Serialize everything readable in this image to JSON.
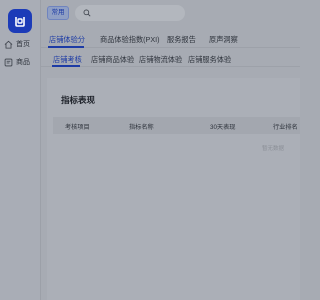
{
  "sidebar": {
    "logo_icon": "app-logo-icon",
    "items": [
      {
        "label": "首页",
        "icon": "home-icon"
      },
      {
        "label": "商品",
        "icon": "product-icon"
      }
    ]
  },
  "topbar": {
    "tag": "常用",
    "search_icon": "search-icon",
    "search_placeholder": ""
  },
  "primary_tabs": [
    {
      "label": "店铺体验分",
      "active": true
    },
    {
      "label": "商品体验指数(PXI)",
      "active": false
    },
    {
      "label": "服务报告",
      "active": false
    },
    {
      "label": "原声洞察",
      "active": false
    }
  ],
  "secondary_tabs": [
    {
      "label": "店铺考核",
      "active": true
    },
    {
      "label": "店铺商品体验",
      "active": false
    },
    {
      "label": "店铺物流体验",
      "active": false
    },
    {
      "label": "店铺服务体验",
      "active": false
    }
  ],
  "metrics": {
    "title": "指标表现",
    "columns": [
      "考核项目",
      "指标名称",
      "30天表现",
      "行业排名"
    ],
    "empty_text": "暂无数据"
  },
  "colors": {
    "accent": "#1d3ba5",
    "logo_bg": "#1c3bb8"
  }
}
